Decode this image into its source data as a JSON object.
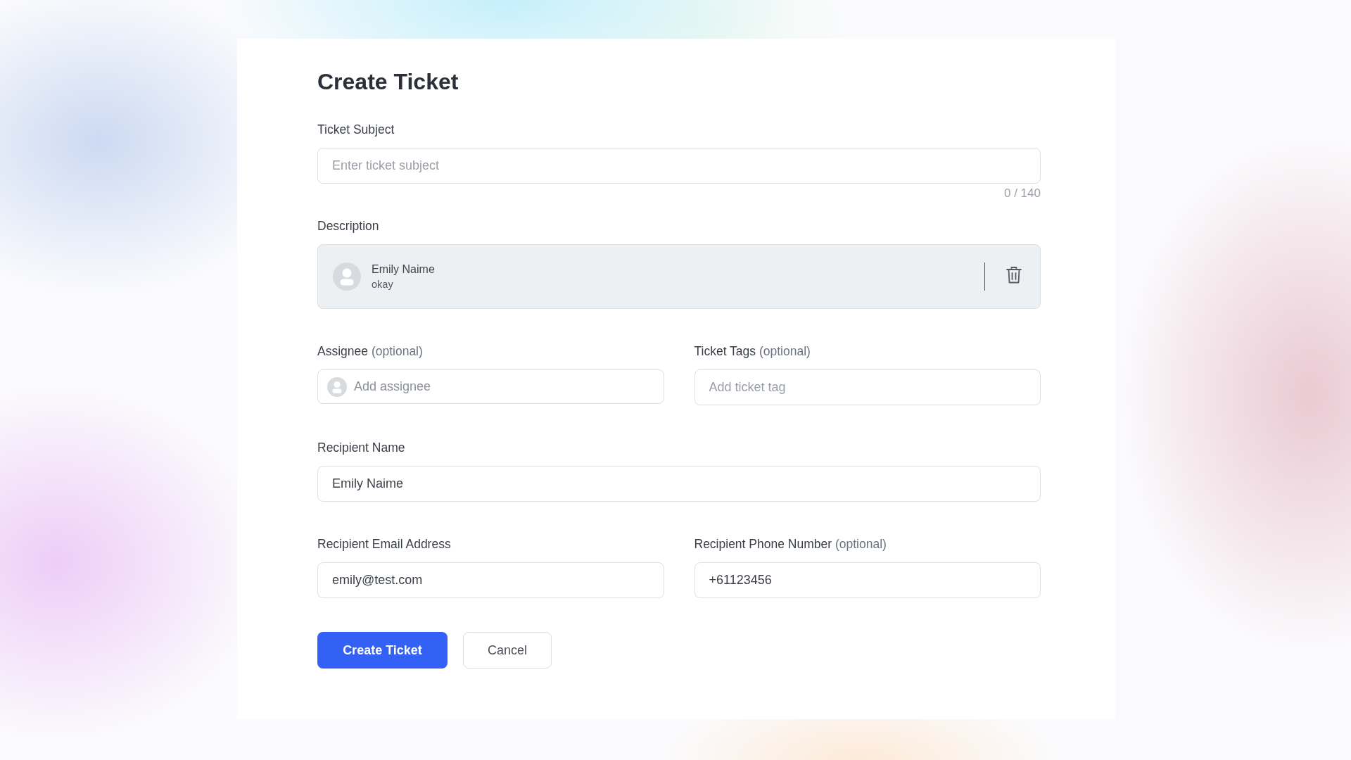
{
  "title": "Create Ticket",
  "rows": [
    {
      "fields": [
        {
          "kind": "text",
          "label": "Ticket Subject",
          "placeholder": "Enter ticket subject",
          "counter": "0 / 140"
        }
      ]
    },
    {
      "fields": [
        {
          "kind": "comment",
          "label": "Description",
          "author": "Emily Naime",
          "text": "okay"
        }
      ]
    },
    {
      "fields": [
        {
          "kind": "person",
          "label": "Assignee",
          "hint": "(optional)",
          "placeholder": "Add assignee"
        },
        {
          "kind": "text",
          "label": "Ticket Tags",
          "hint": "(optional)",
          "placeholder": "Add ticket tag"
        }
      ]
    },
    {
      "fields": [
        {
          "kind": "text",
          "label": "Recipient Name",
          "value": "Emily Naime"
        }
      ]
    },
    {
      "fields": [
        {
          "kind": "text",
          "label": "Recipient Email Address",
          "value": "emily@test.com"
        },
        {
          "kind": "text",
          "label": "Recipient Phone Number",
          "hint": "(optional)",
          "value": "+61123456"
        }
      ]
    }
  ],
  "buttons": [
    {
      "kind": "primary",
      "label": "Create Ticket"
    },
    {
      "kind": "secondary",
      "label": "Cancel"
    }
  ]
}
